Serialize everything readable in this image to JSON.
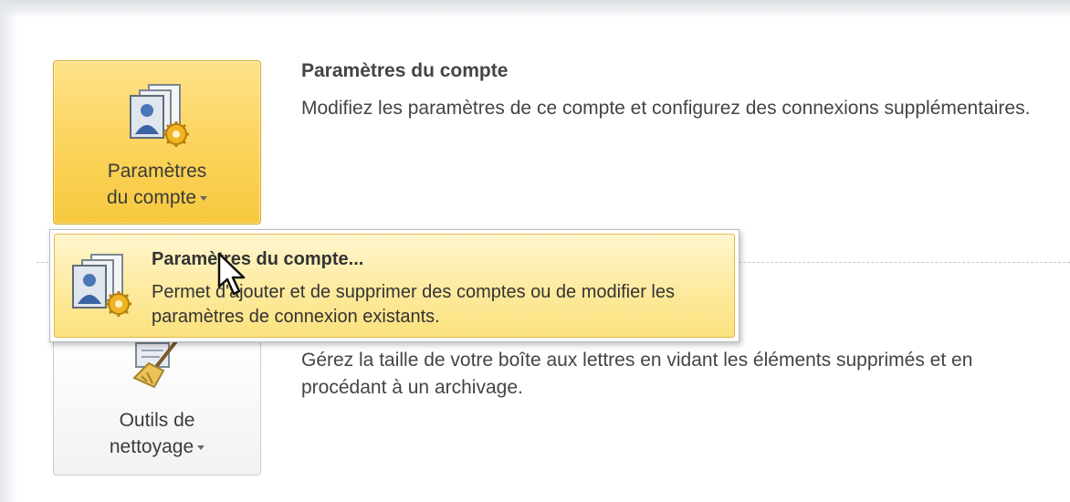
{
  "account_settings": {
    "button_label_line1": "Paramètres",
    "button_label_line2": "du compte",
    "title": "Paramètres du compte",
    "description": "Modifiez les paramètres de ce compte et configurez des connexions supplémentaires.",
    "icon": "account-settings-icon"
  },
  "dropdown": {
    "items": [
      {
        "title": "Paramètres du compte...",
        "description": "Permet d'ajouter et de supprimer des comptes ou de modifier les paramètres de connexion existants.",
        "icon": "account-settings-icon"
      }
    ]
  },
  "cleanup_tools": {
    "button_label_line1": "Outils de",
    "button_label_line2": "nettoyage",
    "description": "Gérez la taille de votre boîte aux lettres en vidant les éléments supprimés et en procédant à un archivage.",
    "icon": "broom-icon"
  },
  "colors": {
    "highlight": "#fbd35a",
    "menu_highlight": "#fde99a",
    "text": "#444444"
  }
}
